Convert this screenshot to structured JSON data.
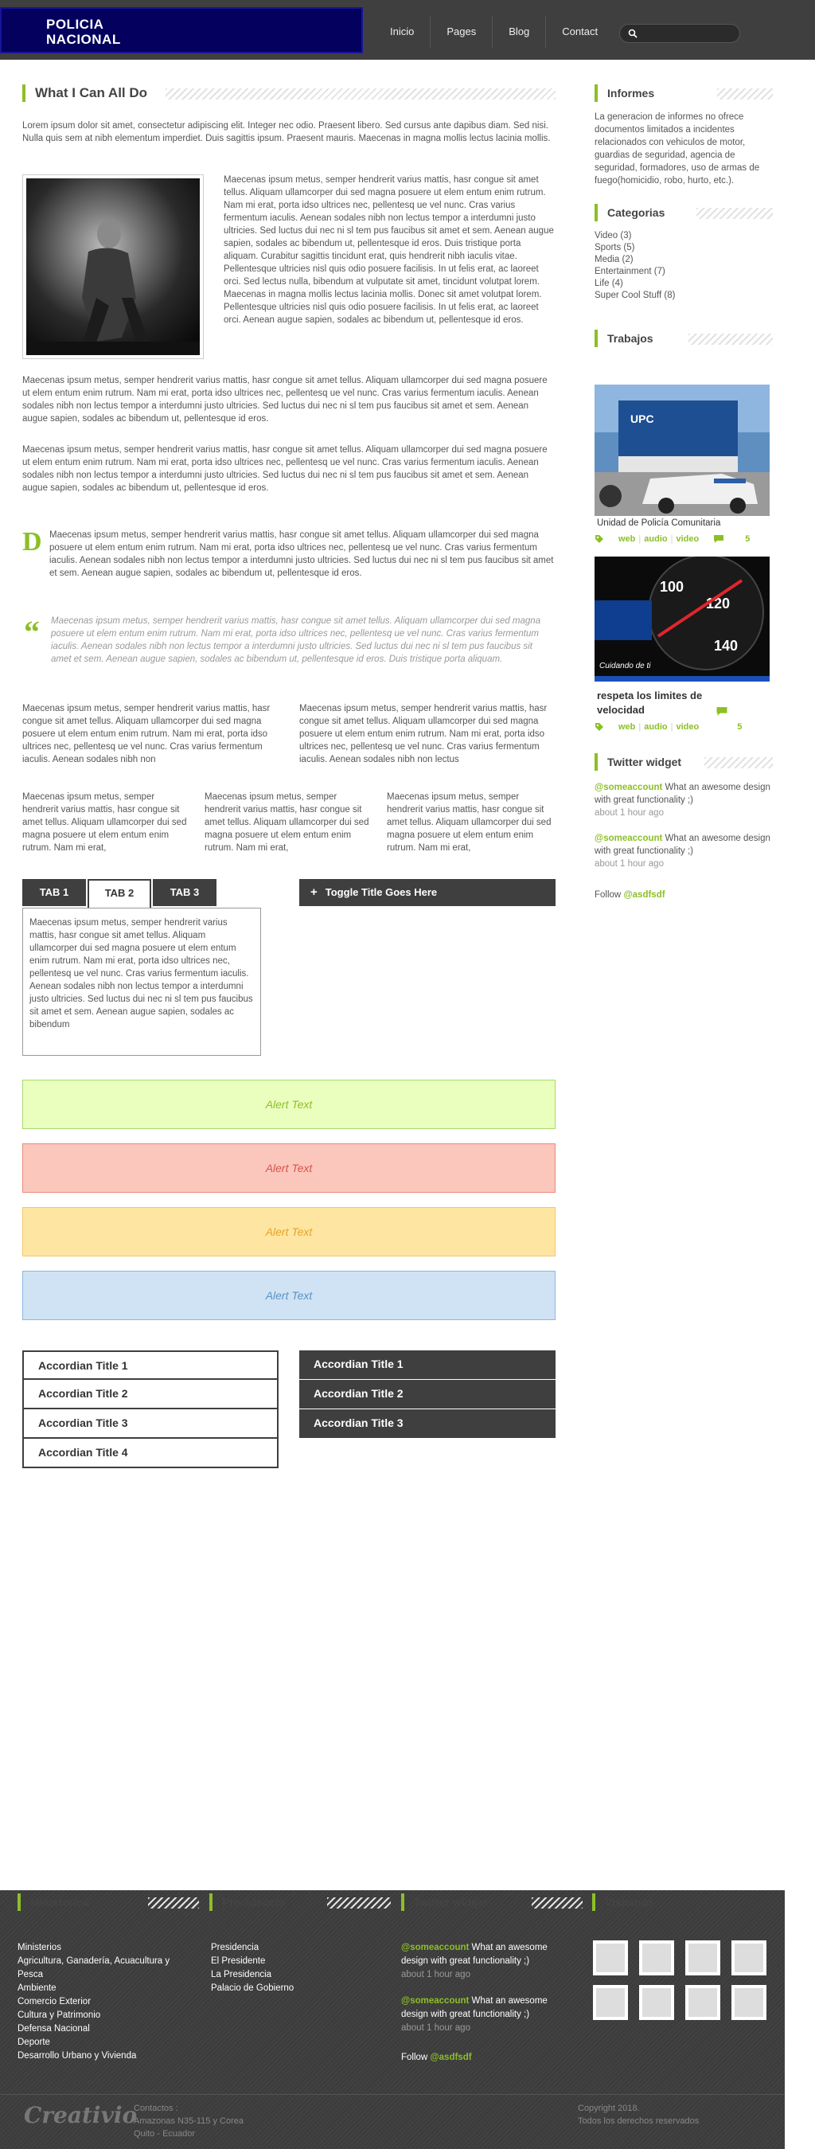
{
  "header": {
    "logo_line1": "POLICIA",
    "logo_line2": "NACIONAL",
    "nav": [
      "Inicio",
      "Pages",
      "Blog",
      "Contact"
    ],
    "search_placeholder": ""
  },
  "main": {
    "title": "What I Can All Do",
    "intro": "Lorem ipsum dolor sit amet, consectetur adipiscing elit. Integer nec odio. Praesent libero. Sed cursus ante dapibus diam. Sed nisi. Nulla quis sem at nibh elementum imperdiet. Duis sagittis ipsum. Praesent mauris. Maecenas in magna mollis lectus lacinia mollis.",
    "beside_photo": "Maecenas ipsum metus, semper hendrerit varius mattis, hasr congue sit amet tellus. Aliquam ullamcorper dui sed magna posuere ut elem entum enim rutrum. Nam mi erat, porta idso ultrices nec, pellentesq ue vel nunc. Cras varius fermentum iaculis. Aenean sodales nibh non lectus tempor a interdumni justo ultricies. Sed luctus dui nec ni sl tem pus faucibus sit amet et sem. Aenean augue sapien, sodales ac bibendum ut, pellentesque id eros. Duis tristique porta aliquam. Curabitur sagittis tincidunt erat, quis hendrerit nibh iaculis vitae. Pellentesque ultricies nisl quis odio posuere facilisis. In ut felis erat, ac laoreet orci. Sed lectus nulla, bibendum at vulputate sit amet, tincidunt volutpat lorem. Maecenas in magna mollis lectus lacinia mollis. Donec sit amet volutpat lorem. Pellentesque ultricies nisl quis odio posuere facilisis. In ut felis erat, ac laoreet orci.  Aenean augue sapien, sodales ac bibendum ut, pellentesque id eros.",
    "para2": "Maecenas ipsum metus, semper hendrerit varius mattis, hasr congue sit amet tellus. Aliquam ullamcorper dui sed magna posuere ut elem entum enim rutrum. Nam mi erat, porta idso ultrices nec, pellentesq ue vel nunc. Cras varius fermentum iaculis. Aenean sodales nibh non lectus tempor a interdumni justo ultricies. Sed luctus dui nec ni sl tem pus faucibus sit amet et sem. Aenean augue sapien, sodales ac bibendum ut, pellentesque id eros.",
    "para3": "Maecenas ipsum metus, semper hendrerit varius mattis, hasr congue sit amet tellus. Aliquam ullamcorper dui sed magna posuere ut elem entum enim rutrum. Nam mi erat, porta idso ultrices nec, pellentesq ue vel nunc. Cras varius fermentum iaculis. Aenean sodales nibh non lectus tempor a interdumni justo ultricies. Sed luctus dui nec ni sl tem pus faucibus sit amet et sem. Aenean augue sapien, sodales ac bibendum ut, pellentesque id eros.",
    "dropcap_letter": "D",
    "dropcap_text": "Maecenas ipsum metus, semper hendrerit varius mattis, hasr congue sit amet tellus. Aliquam ullamcorper dui sed magna posuere ut elem entum enim rutrum. Nam mi erat, porta idso ultrices nec, pellentesq ue vel nunc. Cras varius fermentum iaculis. Aenean sodales nibh non lectus tempor a interdumni justo ultricies. Sed luctus dui nec ni sl tem pus faucibus sit amet et sem. Aenean augue sapien, sodales ac bibendum ut, pellentesque id eros.",
    "quote_mark": "“",
    "quote": "Maecenas ipsum metus, semper hendrerit varius mattis, hasr congue sit amet tellus. Aliquam ullamcorper dui sed magna posuere ut elem entum enim rutrum. Nam mi erat, porta idso ultrices nec, pellentesq ue vel nunc. Cras varius fermentum iaculis. Aenean sodales nibh non lectus tempor a interdumni justo ultricies. Sed luctus dui nec ni sl tem pus faucibus sit amet et sem. Aenean augue sapien, sodales ac bibendum ut, pellentesque id eros. Duis tristique porta aliquam.",
    "two_col": [
      "Maecenas ipsum metus, semper hendrerit varius mattis, hasr congue sit amet tellus. Aliquam ullamcorper dui sed magna posuere ut elem entum enim rutrum. Nam mi erat, porta idso ultrices nec, pellentesq ue vel nunc. Cras varius fermentum iaculis. Aenean sodales nibh non",
      "Maecenas ipsum metus, semper hendrerit varius mattis, hasr congue sit amet tellus. Aliquam ullamcorper dui sed magna posuere ut elem entum enim rutrum. Nam mi erat, porta idso ultrices nec, pellentesq ue vel nunc. Cras varius fermentum iaculis. Aenean sodales nibh non lectus"
    ],
    "three_col": [
      "Maecenas ipsum metus, semper hendrerit varius mattis, hasr congue sit amet tellus. Aliquam ullamcorper dui sed magna posuere ut elem entum enim rutrum. Nam mi erat,",
      "Maecenas ipsum metus, semper hendrerit varius mattis, hasr congue sit amet tellus. Aliquam ullamcorper dui sed magna posuere ut elem entum enim rutrum. Nam mi erat,",
      "Maecenas ipsum metus, semper hendrerit varius mattis, hasr congue sit amet tellus. Aliquam ullamcorper dui sed magna posuere ut elem entum enim rutrum. Nam mi erat,"
    ],
    "tabs": [
      "TAB 1",
      "TAB 2",
      "TAB 3"
    ],
    "tab_content": "Maecenas ipsum metus, semper hendrerit varius mattis, hasr congue sit amet tellus. Aliquam ullamcorper dui sed magna posuere ut elem entum enim rutrum. Nam mi erat, porta idso ultrices nec, pellentesq ue vel nunc. Cras varius fermentum iaculis. Aenean sodales nibh non lectus tempor a interdumni justo ultricies. Sed luctus dui nec ni sl tem pus faucibus sit amet et sem. Aenean augue sapien, sodales ac bibendum",
    "toggle_icon": "+",
    "toggle_title": "Toggle Title Goes Here",
    "alerts": [
      "Alert Text",
      "Alert Text",
      "Alert Text",
      "Alert Text"
    ],
    "alert_colors": {
      "success": "#eaffbe",
      "error": "#fbc7bc",
      "warning": "#ffe5a2",
      "info": "#cfe3f4"
    },
    "accordion_light": [
      "Accordian Title 1",
      "Accordian Title 2",
      "Accordian Title 3",
      "Accordian Title 4"
    ],
    "accordion_dark": [
      "Accordian Title 1",
      "Accordian Title 2",
      "Accordian Title 3"
    ]
  },
  "sidebar": {
    "informes_title": "Informes",
    "informes_text": "La generacion de informes no ofrece documentos limitados a incidentes relacionados con vehiculos de motor, guardias de seguridad, agencia de seguridad, formadores, uso de armas de fuego(homicidio, robo, hurto, etc.).",
    "categorias_title": "Categorias",
    "categories": [
      "Video (3)",
      "Sports (5)",
      "Media (2)",
      "Entertainment (7)",
      "Life (4)",
      "Super Cool Stuff (8)"
    ],
    "trabajos_title": "Trabajos",
    "works": [
      {
        "title": "Unidad de Policía Comunitaria",
        "img_label": "UPC",
        "links": [
          "web",
          "audio",
          "video"
        ],
        "comments": "5"
      },
      {
        "title": "respeta los limites de velocidad",
        "img_label": "Cuidando de ti",
        "links": [
          "web",
          "audio",
          "video"
        ],
        "comments": "5"
      }
    ],
    "twitter_title": "Twitter widget",
    "tweets": [
      {
        "handle": "@someaccount",
        "text": " What an awesome design with great functionality ;)",
        "time": "about 1 hour ago"
      },
      {
        "handle": "@someaccount",
        "text": " What an awesome design with great functionality ;)",
        "time": "about 1 hour ago"
      }
    ],
    "follow_label": "Follow ",
    "follow_handle": "@asdfsdf"
  },
  "footer": {
    "ministerios_title": "Ministerios",
    "ministerios": [
      "Ministerios",
      "Agricultura, Ganadería, Acuacultura y",
      "Pesca",
      "Ambiente",
      "Comercio Exterior",
      "Cultura y Patrimonio",
      "Defensa Nacional",
      "Deporte",
      "Desarrollo Urbano y Vivienda"
    ],
    "precidencia_title": "Precidencia",
    "precidencia": [
      "Presidencia",
      "El Presidente",
      "La Presidencia",
      "Palacio de Gobierno"
    ],
    "twitter_title": "Twitter widget",
    "tweets": [
      {
        "handle": "@someaccount",
        "text": " What an awesome design with great functionality ;)",
        "time": "about 1 hour ago"
      },
      {
        "handle": "@someaccount",
        "text": " What an awesome design with great functionality ;)",
        "time": "about 1 hour ago"
      }
    ],
    "follow_label": "Follow ",
    "follow_handle": "@asdfsdf",
    "visitanos_title": "Visitanos",
    "logo": "Creativio",
    "contact_lines": [
      "Contactos :",
      "Amazonas N35-115 y Corea",
      "Quito - Ecuador"
    ],
    "copyright_lines": [
      "Copyright 2018.",
      "Todos los derechos reservados"
    ]
  },
  "colors": {
    "accent": "#8cbf26",
    "header_bg": "#3f3f3f",
    "logo_bg": "#03015d"
  }
}
